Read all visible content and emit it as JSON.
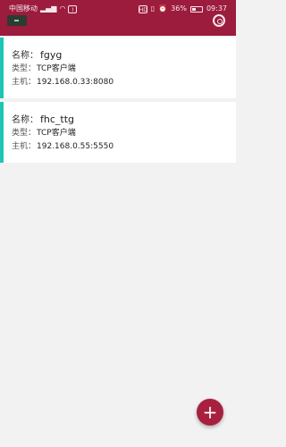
{
  "status_bar": {
    "carrier": "中国移动",
    "signal_label": "HD",
    "battery_percent": "36%",
    "battery_level": 0.36,
    "time": "09:37"
  },
  "connections": [
    {
      "name_label": "名称：",
      "name": "fgyg",
      "type_label": "类型：",
      "type": "TCP客户端",
      "host_label": "主机：",
      "host": "192.168.0.33:8080"
    },
    {
      "name_label": "名称：",
      "name": "fhc_ttg",
      "type_label": "类型：",
      "type": "TCP客户端",
      "host_label": "主机：",
      "host": "192.168.0.55:5550"
    }
  ],
  "colors": {
    "header": "#9c1c3e",
    "accent": "#1fc6b4",
    "fab": "#a8203f"
  },
  "icons": {
    "settings": "settings-icon",
    "add": "add-icon"
  }
}
